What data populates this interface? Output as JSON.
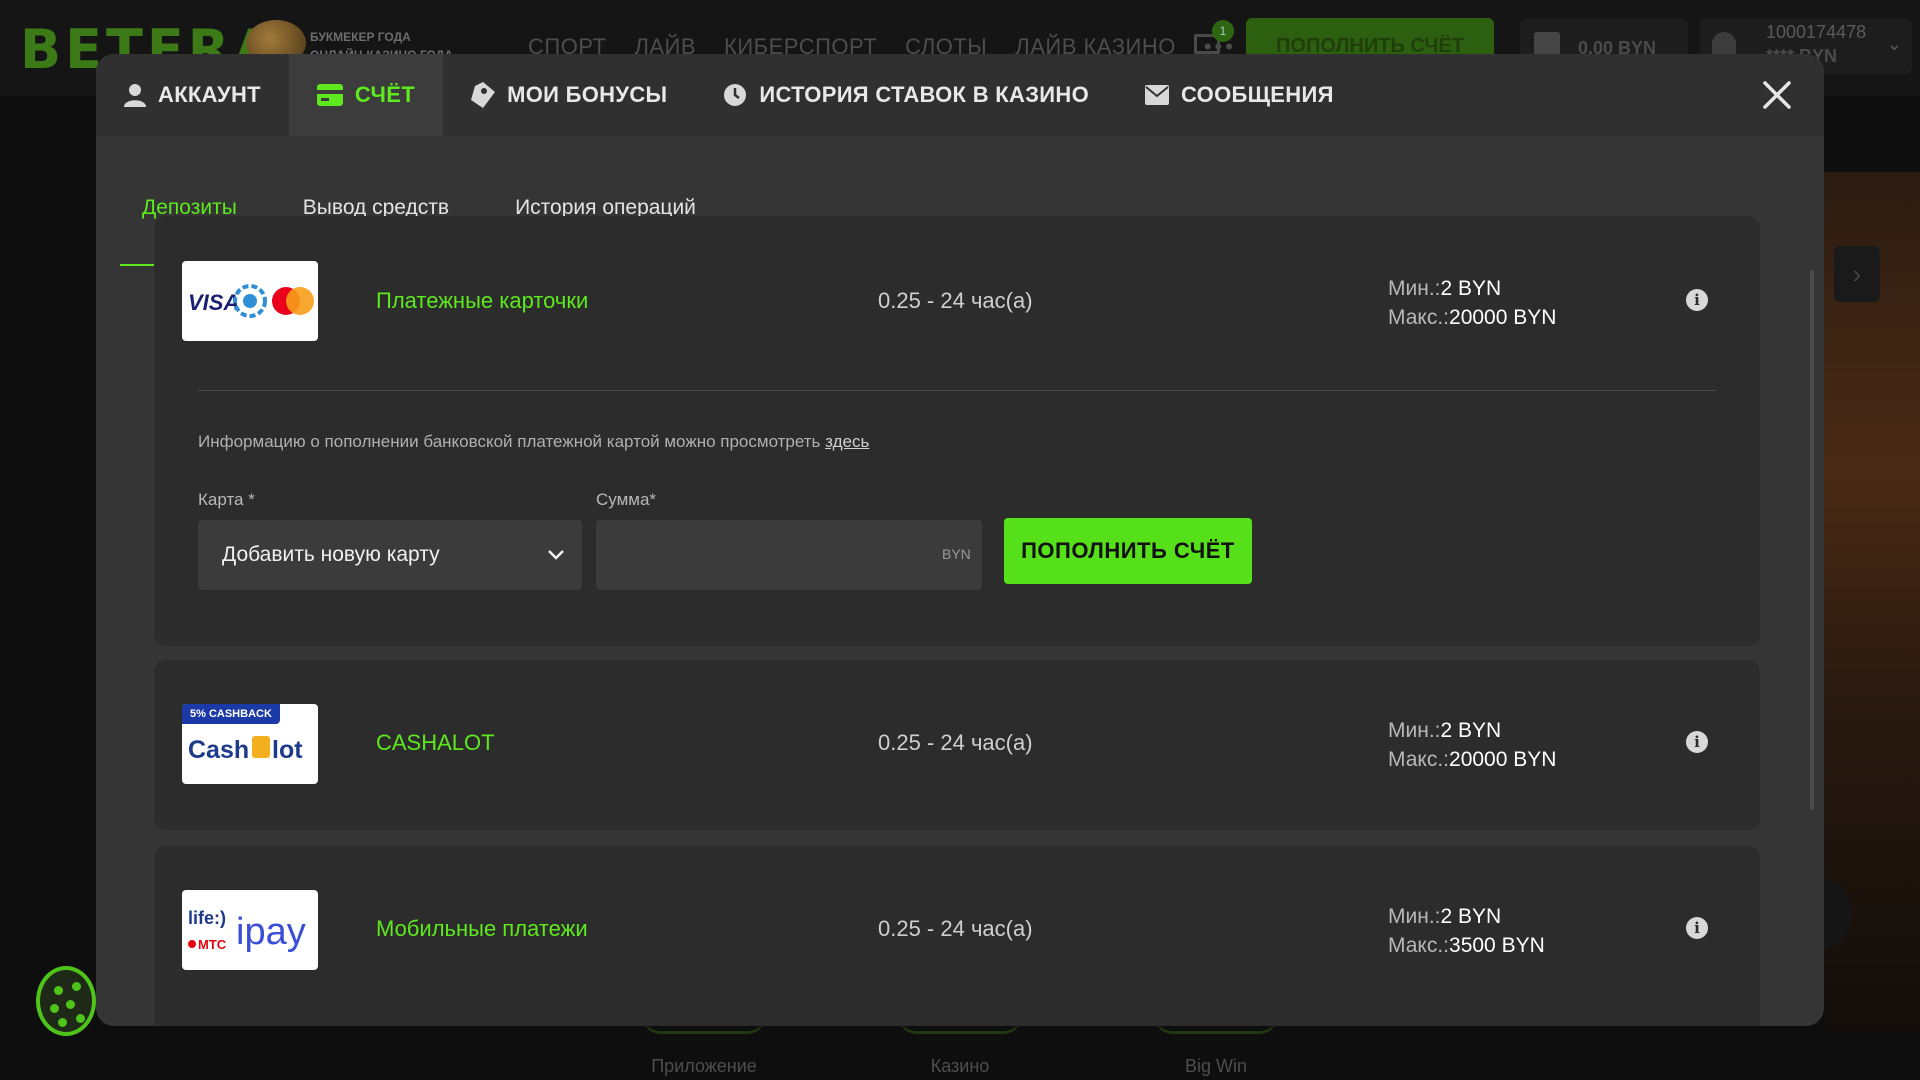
{
  "header": {
    "logo": "BETERA",
    "award_line1": "БУКМЕКЕР ГОДА",
    "award_line2": "ОНЛАЙН-КАЗИНО ГОДА",
    "nav": [
      "СПОРТ",
      "ЛАЙВ",
      "КИБЕРСПОРТ",
      "СЛОТЫ",
      "ЛАЙВ КАЗИНО",
      "•••"
    ],
    "mail_badge": "1",
    "deposit_label": "ПОПОЛНИТЬ СЧЁТ",
    "bonus_balance": "0.00 BYN",
    "user_id": "1000174478",
    "user_balance": "**** BYN"
  },
  "modal": {
    "tabs": [
      {
        "label": "АККАУНТ",
        "icon": "user-icon"
      },
      {
        "label": "СЧЁТ",
        "icon": "wallet-icon",
        "active": true
      },
      {
        "label": "МОИ БОНУСЫ",
        "icon": "tag-icon"
      },
      {
        "label": "ИСТОРИЯ СТАВОК В КАЗИНО",
        "icon": "clock-icon"
      },
      {
        "label": "СООБЩЕНИЯ",
        "icon": "mail-icon"
      }
    ],
    "subtabs": [
      "Депозиты",
      "Вывод средств",
      "История операций"
    ],
    "active_subtab": "Депозиты",
    "methods": [
      {
        "name": "Платежные карточки",
        "time": "0.25 - 24 час(а)",
        "min_label": "Мин.:",
        "min_value": "2 BYN",
        "max_label": "Макс.:",
        "max_value": "20000 BYN",
        "logo": "VISA / Belkart / Mastercard"
      },
      {
        "name": "CASHALOT",
        "time": "0.25 - 24 час(а)",
        "min_label": "Мин.:",
        "min_value": "2 BYN",
        "max_label": "Макс.:",
        "max_value": "20000 BYN",
        "badge": "5% CASHBACK",
        "logo": "Cashalot"
      },
      {
        "name": "Мобильные платежи",
        "time": "0.25 - 24 час(а)",
        "min_label": "Мин.:",
        "min_value": "2 BYN",
        "max_label": "Макс.:",
        "max_value": "3500 BYN",
        "logo": "life:) МТС ipay"
      }
    ],
    "form": {
      "info_text": "Информацию о пополнении банковской платежной картой можно просмотреть",
      "info_link": "здесь",
      "card_label": "Карта *",
      "card_value": "Добавить новую карту",
      "amount_label": "Сумма*",
      "amount_value": "",
      "currency": "BYN",
      "submit_label": "ПОПОЛНИТЬ СЧЁТ"
    }
  },
  "bottom_tabs": [
    "Приложение",
    "Казино",
    "Big Win"
  ],
  "colors": {
    "accent": "#5ee81e",
    "button": "#56e01a",
    "modal_bg": "#343534",
    "card_bg": "#2b2c2b"
  }
}
